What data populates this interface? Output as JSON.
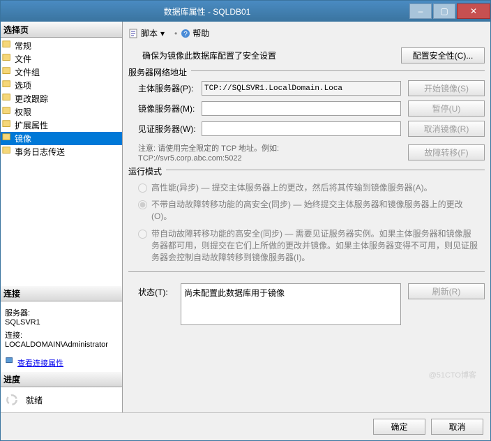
{
  "title": "数据库属性 - SQLDB01",
  "titlebar": {
    "min": "–",
    "max": "▢",
    "close": "✕"
  },
  "toolbar": {
    "script": "脚本",
    "script_arrow": "▾",
    "sep": "•",
    "help": "帮助"
  },
  "left": {
    "select_page": "选择页",
    "nav": [
      "常规",
      "文件",
      "文件组",
      "选项",
      "更改跟踪",
      "权限",
      "扩展属性",
      "镜像",
      "事务日志传送"
    ],
    "connection_hdr": "连接",
    "server_lbl": "服务器:",
    "server_val": "SQLSVR1",
    "conn_lbl": "连接:",
    "conn_val": "LOCALDOMAIN\\Administrator",
    "view_conn": "查看连接属性",
    "progress_hdr": "进度",
    "ready": "就绪"
  },
  "main": {
    "ensure_text": "确保为镜像此数据库配置了安全设置",
    "config_sec_btn": "配置安全性(C)...",
    "net_addr_legend": "服务器网络地址",
    "principal_lbl": "主体服务器(P):",
    "principal_val": "TCP://SQLSVR1.LocalDomain.Loca",
    "mirror_lbl": "镜像服务器(M):",
    "witness_lbl": "见证服务器(W):",
    "start_btn": "开始镜像(S)",
    "pause_btn": "暂停(U)",
    "remove_btn": "取消镜像(R)",
    "failover_btn": "故障转移(F)",
    "note_lbl": "注意: 请使用完全限定的 TCP 地址。例如:",
    "note_ex": "TCP://svr5.corp.abc.com:5022",
    "mode_legend": "运行模式",
    "mode1": "高性能(异步) — 提交主体服务器上的更改，然后将其传输到镜像服务器(A)。",
    "mode2": "不带自动故障转移功能的高安全(同步) — 始终提交主体服务器和镜像服务器上的更改(O)。",
    "mode3": "带自动故障转移功能的高安全(同步) — 需要见证服务器实例。如果主体服务器和镜像服务器都可用，则提交在它们上所做的更改并镜像。如果主体服务器变得不可用，则见证服务器会控制自动故障转移到镜像服务器(I)。",
    "status_lbl": "状态(T):",
    "status_val": "尚未配置此数据库用于镜像",
    "refresh_btn": "刷新(R)"
  },
  "footer": {
    "ok": "确定",
    "cancel": "取消"
  },
  "watermark": "@51CTO博客"
}
